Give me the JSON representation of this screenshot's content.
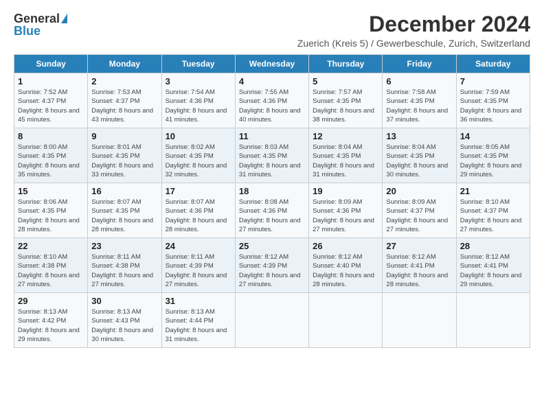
{
  "logo": {
    "general": "General",
    "blue": "Blue"
  },
  "header": {
    "month_year": "December 2024",
    "location": "Zuerich (Kreis 5) / Gewerbeschule, Zurich, Switzerland"
  },
  "days_of_week": [
    "Sunday",
    "Monday",
    "Tuesday",
    "Wednesday",
    "Thursday",
    "Friday",
    "Saturday"
  ],
  "weeks": [
    [
      {
        "day": 1,
        "sunrise": "Sunrise: 7:52 AM",
        "sunset": "Sunset: 4:37 PM",
        "daylight": "Daylight: 8 hours and 45 minutes."
      },
      {
        "day": 2,
        "sunrise": "Sunrise: 7:53 AM",
        "sunset": "Sunset: 4:37 PM",
        "daylight": "Daylight: 8 hours and 43 minutes."
      },
      {
        "day": 3,
        "sunrise": "Sunrise: 7:54 AM",
        "sunset": "Sunset: 4:36 PM",
        "daylight": "Daylight: 8 hours and 41 minutes."
      },
      {
        "day": 4,
        "sunrise": "Sunrise: 7:55 AM",
        "sunset": "Sunset: 4:36 PM",
        "daylight": "Daylight: 8 hours and 40 minutes."
      },
      {
        "day": 5,
        "sunrise": "Sunrise: 7:57 AM",
        "sunset": "Sunset: 4:35 PM",
        "daylight": "Daylight: 8 hours and 38 minutes."
      },
      {
        "day": 6,
        "sunrise": "Sunrise: 7:58 AM",
        "sunset": "Sunset: 4:35 PM",
        "daylight": "Daylight: 8 hours and 37 minutes."
      },
      {
        "day": 7,
        "sunrise": "Sunrise: 7:59 AM",
        "sunset": "Sunset: 4:35 PM",
        "daylight": "Daylight: 8 hours and 36 minutes."
      }
    ],
    [
      {
        "day": 8,
        "sunrise": "Sunrise: 8:00 AM",
        "sunset": "Sunset: 4:35 PM",
        "daylight": "Daylight: 8 hours and 35 minutes."
      },
      {
        "day": 9,
        "sunrise": "Sunrise: 8:01 AM",
        "sunset": "Sunset: 4:35 PM",
        "daylight": "Daylight: 8 hours and 33 minutes."
      },
      {
        "day": 10,
        "sunrise": "Sunrise: 8:02 AM",
        "sunset": "Sunset: 4:35 PM",
        "daylight": "Daylight: 8 hours and 32 minutes."
      },
      {
        "day": 11,
        "sunrise": "Sunrise: 8:03 AM",
        "sunset": "Sunset: 4:35 PM",
        "daylight": "Daylight: 8 hours and 31 minutes."
      },
      {
        "day": 12,
        "sunrise": "Sunrise: 8:04 AM",
        "sunset": "Sunset: 4:35 PM",
        "daylight": "Daylight: 8 hours and 31 minutes."
      },
      {
        "day": 13,
        "sunrise": "Sunrise: 8:04 AM",
        "sunset": "Sunset: 4:35 PM",
        "daylight": "Daylight: 8 hours and 30 minutes."
      },
      {
        "day": 14,
        "sunrise": "Sunrise: 8:05 AM",
        "sunset": "Sunset: 4:35 PM",
        "daylight": "Daylight: 8 hours and 29 minutes."
      }
    ],
    [
      {
        "day": 15,
        "sunrise": "Sunrise: 8:06 AM",
        "sunset": "Sunset: 4:35 PM",
        "daylight": "Daylight: 8 hours and 28 minutes."
      },
      {
        "day": 16,
        "sunrise": "Sunrise: 8:07 AM",
        "sunset": "Sunset: 4:35 PM",
        "daylight": "Daylight: 8 hours and 28 minutes."
      },
      {
        "day": 17,
        "sunrise": "Sunrise: 8:07 AM",
        "sunset": "Sunset: 4:36 PM",
        "daylight": "Daylight: 8 hours and 28 minutes."
      },
      {
        "day": 18,
        "sunrise": "Sunrise: 8:08 AM",
        "sunset": "Sunset: 4:36 PM",
        "daylight": "Daylight: 8 hours and 27 minutes."
      },
      {
        "day": 19,
        "sunrise": "Sunrise: 8:09 AM",
        "sunset": "Sunset: 4:36 PM",
        "daylight": "Daylight: 8 hours and 27 minutes."
      },
      {
        "day": 20,
        "sunrise": "Sunrise: 8:09 AM",
        "sunset": "Sunset: 4:37 PM",
        "daylight": "Daylight: 8 hours and 27 minutes."
      },
      {
        "day": 21,
        "sunrise": "Sunrise: 8:10 AM",
        "sunset": "Sunset: 4:37 PM",
        "daylight": "Daylight: 8 hours and 27 minutes."
      }
    ],
    [
      {
        "day": 22,
        "sunrise": "Sunrise: 8:10 AM",
        "sunset": "Sunset: 4:38 PM",
        "daylight": "Daylight: 8 hours and 27 minutes."
      },
      {
        "day": 23,
        "sunrise": "Sunrise: 8:11 AM",
        "sunset": "Sunset: 4:38 PM",
        "daylight": "Daylight: 8 hours and 27 minutes."
      },
      {
        "day": 24,
        "sunrise": "Sunrise: 8:11 AM",
        "sunset": "Sunset: 4:39 PM",
        "daylight": "Daylight: 8 hours and 27 minutes."
      },
      {
        "day": 25,
        "sunrise": "Sunrise: 8:12 AM",
        "sunset": "Sunset: 4:39 PM",
        "daylight": "Daylight: 8 hours and 27 minutes."
      },
      {
        "day": 26,
        "sunrise": "Sunrise: 8:12 AM",
        "sunset": "Sunset: 4:40 PM",
        "daylight": "Daylight: 8 hours and 28 minutes."
      },
      {
        "day": 27,
        "sunrise": "Sunrise: 8:12 AM",
        "sunset": "Sunset: 4:41 PM",
        "daylight": "Daylight: 8 hours and 28 minutes."
      },
      {
        "day": 28,
        "sunrise": "Sunrise: 8:12 AM",
        "sunset": "Sunset: 4:41 PM",
        "daylight": "Daylight: 8 hours and 29 minutes."
      }
    ],
    [
      {
        "day": 29,
        "sunrise": "Sunrise: 8:13 AM",
        "sunset": "Sunset: 4:42 PM",
        "daylight": "Daylight: 8 hours and 29 minutes."
      },
      {
        "day": 30,
        "sunrise": "Sunrise: 8:13 AM",
        "sunset": "Sunset: 4:43 PM",
        "daylight": "Daylight: 8 hours and 30 minutes."
      },
      {
        "day": 31,
        "sunrise": "Sunrise: 8:13 AM",
        "sunset": "Sunset: 4:44 PM",
        "daylight": "Daylight: 8 hours and 31 minutes."
      },
      null,
      null,
      null,
      null
    ]
  ]
}
